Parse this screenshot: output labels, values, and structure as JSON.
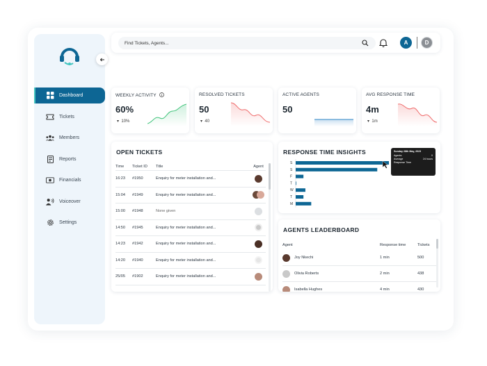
{
  "nav": {
    "items": [
      {
        "label": "Dashboard",
        "icon": "dashboard-icon",
        "active": true
      },
      {
        "label": "Tickets",
        "icon": "ticket-icon",
        "active": false
      },
      {
        "label": "Members",
        "icon": "members-icon",
        "active": false
      },
      {
        "label": "Reports",
        "icon": "reports-icon",
        "active": false
      },
      {
        "label": "Financials",
        "icon": "financials-icon",
        "active": false
      },
      {
        "label": "Voiceover",
        "icon": "voiceover-icon",
        "active": false
      },
      {
        "label": "Settings",
        "icon": "settings-icon",
        "active": false
      }
    ]
  },
  "search": {
    "placeholder": "Find Tickets, Agents..."
  },
  "header": {
    "avatar_primary": "A",
    "avatar_secondary": "D"
  },
  "stats": {
    "weekly_activity": {
      "title": "WEEKLY ACTIVITY",
      "value": "60%",
      "delta": "10%"
    },
    "resolved_tickets": {
      "title": "RESOLVED TICKETS",
      "value": "50",
      "delta": "40"
    },
    "active_agents": {
      "title": "ACTIVE AGENTS",
      "value": "50"
    },
    "avg_response_time": {
      "title": "AVG RESPONSE TIME",
      "value": "4m",
      "delta": "1m"
    }
  },
  "open_tickets": {
    "title": "OPEN TICKETS",
    "columns": [
      "Time",
      "Ticket ID",
      "Title",
      "Agent"
    ],
    "rows": [
      {
        "time": "16:23",
        "id": "#1950",
        "title": "Enquiry for meter installation and..."
      },
      {
        "time": "15:04",
        "id": "#1949",
        "title": "Enquiry for meter installation and..."
      },
      {
        "time": "15:00",
        "id": "#1948",
        "title": "None given"
      },
      {
        "time": "14:50",
        "id": "#1945",
        "title": "Enquiry for meter installation and..."
      },
      {
        "time": "14:23",
        "id": "#1942",
        "title": "Enquiry for meter installation and..."
      },
      {
        "time": "14:20",
        "id": "#1940",
        "title": "Enquiry for meter installation and..."
      },
      {
        "time": "25/05",
        "id": "#1902",
        "title": "Enquiry for meter installation and..."
      }
    ]
  },
  "response_time": {
    "title": "RESPONSE TIME INSIGHTS",
    "tooltip": {
      "heading": "Sunday 28th May, 2023",
      "agents_label": "Agents:",
      "agents_value": "0",
      "average_label": "Average",
      "average_value": "24 hours",
      "response_label": "Response Time"
    }
  },
  "leaderboard": {
    "title": "AGENTS LEADERBOARD",
    "columns": [
      "Agent",
      "Response time",
      "Tickets"
    ],
    "rows": [
      {
        "name": "Joy Nkechi",
        "response": "1 min",
        "tickets": "500"
      },
      {
        "name": "Olivia Roberts",
        "response": "2 min",
        "tickets": "438"
      },
      {
        "name": "Isabella Hughes",
        "response": "4 min",
        "tickets": "430"
      }
    ]
  },
  "chart_data": {
    "type": "bar",
    "orientation": "horizontal",
    "categories": [
      "S",
      "S",
      "F",
      "T",
      "W",
      "T",
      "M"
    ],
    "values": [
      24,
      21,
      2,
      0,
      2.5,
      2,
      4
    ],
    "xlabel": "",
    "ylabel": "",
    "xlim": [
      0,
      24
    ],
    "color": "#0d6694"
  },
  "colors": {
    "primary": "#0d6694",
    "accent_teal": "#44c6c0",
    "spark_green": "#3fc37a",
    "spark_red": "#ef6b6b"
  }
}
